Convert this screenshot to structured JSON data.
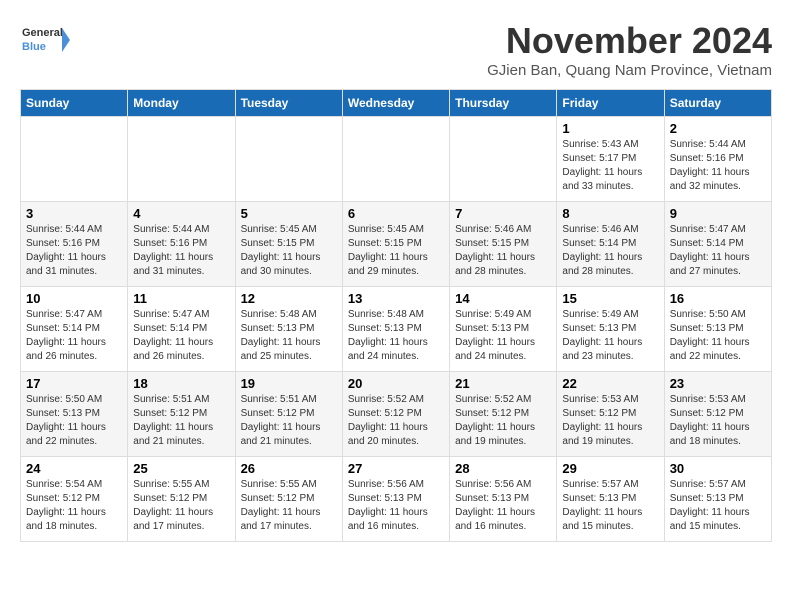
{
  "logo": {
    "text_general": "General",
    "text_blue": "Blue"
  },
  "title": "November 2024",
  "location": "GJien Ban, Quang Nam Province, Vietnam",
  "weekdays": [
    "Sunday",
    "Monday",
    "Tuesday",
    "Wednesday",
    "Thursday",
    "Friday",
    "Saturday"
  ],
  "weeks": [
    [
      {
        "day": "",
        "info": ""
      },
      {
        "day": "",
        "info": ""
      },
      {
        "day": "",
        "info": ""
      },
      {
        "day": "",
        "info": ""
      },
      {
        "day": "",
        "info": ""
      },
      {
        "day": "1",
        "info": "Sunrise: 5:43 AM\nSunset: 5:17 PM\nDaylight: 11 hours\nand 33 minutes."
      },
      {
        "day": "2",
        "info": "Sunrise: 5:44 AM\nSunset: 5:16 PM\nDaylight: 11 hours\nand 32 minutes."
      }
    ],
    [
      {
        "day": "3",
        "info": "Sunrise: 5:44 AM\nSunset: 5:16 PM\nDaylight: 11 hours\nand 31 minutes."
      },
      {
        "day": "4",
        "info": "Sunrise: 5:44 AM\nSunset: 5:16 PM\nDaylight: 11 hours\nand 31 minutes."
      },
      {
        "day": "5",
        "info": "Sunrise: 5:45 AM\nSunset: 5:15 PM\nDaylight: 11 hours\nand 30 minutes."
      },
      {
        "day": "6",
        "info": "Sunrise: 5:45 AM\nSunset: 5:15 PM\nDaylight: 11 hours\nand 29 minutes."
      },
      {
        "day": "7",
        "info": "Sunrise: 5:46 AM\nSunset: 5:15 PM\nDaylight: 11 hours\nand 28 minutes."
      },
      {
        "day": "8",
        "info": "Sunrise: 5:46 AM\nSunset: 5:14 PM\nDaylight: 11 hours\nand 28 minutes."
      },
      {
        "day": "9",
        "info": "Sunrise: 5:47 AM\nSunset: 5:14 PM\nDaylight: 11 hours\nand 27 minutes."
      }
    ],
    [
      {
        "day": "10",
        "info": "Sunrise: 5:47 AM\nSunset: 5:14 PM\nDaylight: 11 hours\nand 26 minutes."
      },
      {
        "day": "11",
        "info": "Sunrise: 5:47 AM\nSunset: 5:14 PM\nDaylight: 11 hours\nand 26 minutes."
      },
      {
        "day": "12",
        "info": "Sunrise: 5:48 AM\nSunset: 5:13 PM\nDaylight: 11 hours\nand 25 minutes."
      },
      {
        "day": "13",
        "info": "Sunrise: 5:48 AM\nSunset: 5:13 PM\nDaylight: 11 hours\nand 24 minutes."
      },
      {
        "day": "14",
        "info": "Sunrise: 5:49 AM\nSunset: 5:13 PM\nDaylight: 11 hours\nand 24 minutes."
      },
      {
        "day": "15",
        "info": "Sunrise: 5:49 AM\nSunset: 5:13 PM\nDaylight: 11 hours\nand 23 minutes."
      },
      {
        "day": "16",
        "info": "Sunrise: 5:50 AM\nSunset: 5:13 PM\nDaylight: 11 hours\nand 22 minutes."
      }
    ],
    [
      {
        "day": "17",
        "info": "Sunrise: 5:50 AM\nSunset: 5:13 PM\nDaylight: 11 hours\nand 22 minutes."
      },
      {
        "day": "18",
        "info": "Sunrise: 5:51 AM\nSunset: 5:12 PM\nDaylight: 11 hours\nand 21 minutes."
      },
      {
        "day": "19",
        "info": "Sunrise: 5:51 AM\nSunset: 5:12 PM\nDaylight: 11 hours\nand 21 minutes."
      },
      {
        "day": "20",
        "info": "Sunrise: 5:52 AM\nSunset: 5:12 PM\nDaylight: 11 hours\nand 20 minutes."
      },
      {
        "day": "21",
        "info": "Sunrise: 5:52 AM\nSunset: 5:12 PM\nDaylight: 11 hours\nand 19 minutes."
      },
      {
        "day": "22",
        "info": "Sunrise: 5:53 AM\nSunset: 5:12 PM\nDaylight: 11 hours\nand 19 minutes."
      },
      {
        "day": "23",
        "info": "Sunrise: 5:53 AM\nSunset: 5:12 PM\nDaylight: 11 hours\nand 18 minutes."
      }
    ],
    [
      {
        "day": "24",
        "info": "Sunrise: 5:54 AM\nSunset: 5:12 PM\nDaylight: 11 hours\nand 18 minutes."
      },
      {
        "day": "25",
        "info": "Sunrise: 5:55 AM\nSunset: 5:12 PM\nDaylight: 11 hours\nand 17 minutes."
      },
      {
        "day": "26",
        "info": "Sunrise: 5:55 AM\nSunset: 5:12 PM\nDaylight: 11 hours\nand 17 minutes."
      },
      {
        "day": "27",
        "info": "Sunrise: 5:56 AM\nSunset: 5:13 PM\nDaylight: 11 hours\nand 16 minutes."
      },
      {
        "day": "28",
        "info": "Sunrise: 5:56 AM\nSunset: 5:13 PM\nDaylight: 11 hours\nand 16 minutes."
      },
      {
        "day": "29",
        "info": "Sunrise: 5:57 AM\nSunset: 5:13 PM\nDaylight: 11 hours\nand 15 minutes."
      },
      {
        "day": "30",
        "info": "Sunrise: 5:57 AM\nSunset: 5:13 PM\nDaylight: 11 hours\nand 15 minutes."
      }
    ]
  ]
}
